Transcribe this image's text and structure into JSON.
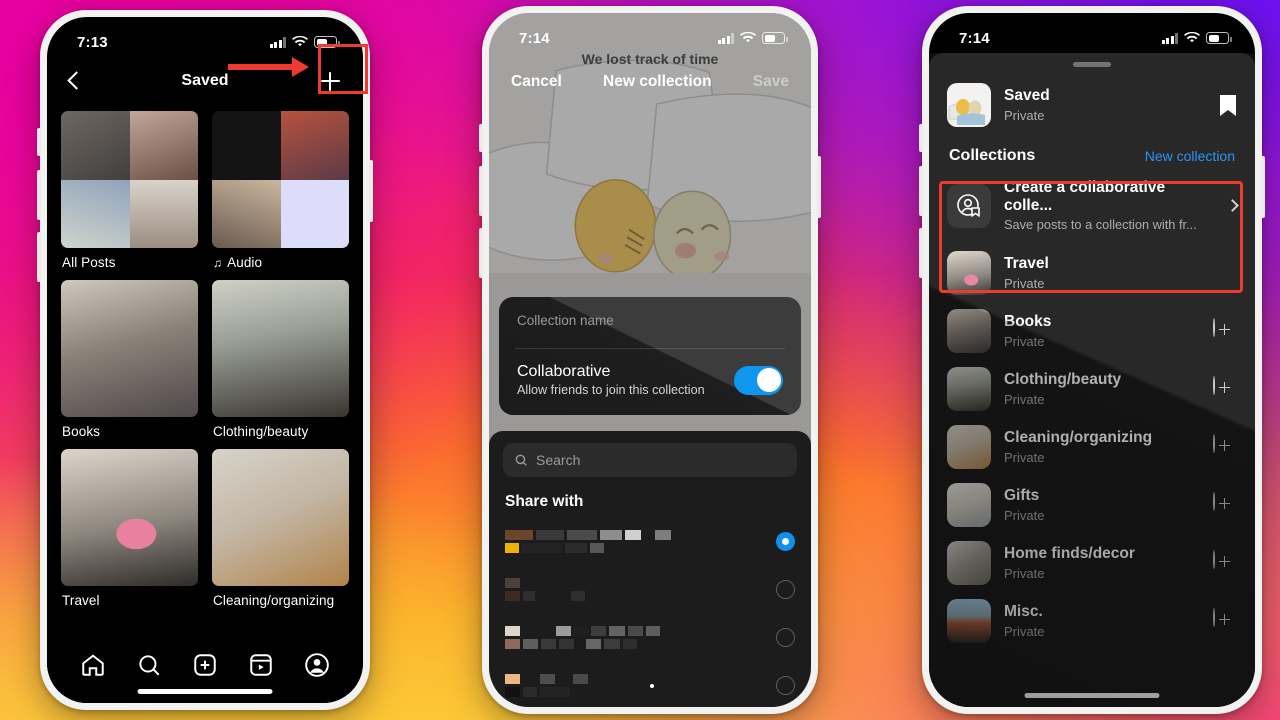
{
  "colors": {
    "accent_blue": "#1f8ff5",
    "toggle_blue": "#0f97f0",
    "annotation_red": "#ee3b30",
    "sheet_bg": "#1c1c1c",
    "screen_bg": "#000000"
  },
  "phone1": {
    "status": {
      "time": "7:13",
      "signal_icon": "cellular-bars-icon",
      "wifi_icon": "wifi-icon",
      "battery_icon": "battery-icon"
    },
    "header": {
      "back_icon": "chevron-left-icon",
      "title": "Saved",
      "add_icon": "plus-icon"
    },
    "collections": [
      {
        "label": "All Posts",
        "icon": "",
        "thumb": "grid-of-four-posts"
      },
      {
        "label": "Audio",
        "icon": "music-note-icon",
        "thumb": "grid-of-four-posts"
      },
      {
        "label": "Books",
        "icon": "",
        "thumb": "book-on-bed-photo"
      },
      {
        "label": "Clothing/beauty",
        "icon": "",
        "thumb": "woman-white-shirt-photo"
      },
      {
        "label": "Travel",
        "icon": "",
        "thumb": "travel-toiletry-bag-photo"
      },
      {
        "label": "Cleaning/organizing",
        "icon": "",
        "thumb": "organized-drawer-photo"
      }
    ],
    "tabbar": [
      {
        "name": "home-icon"
      },
      {
        "name": "search-icon"
      },
      {
        "name": "create-icon"
      },
      {
        "name": "reels-icon"
      },
      {
        "name": "profile-icon"
      }
    ],
    "annotation": {
      "arrow": "red-arrow-pointing-right",
      "highlight": "red-box-around-plus-button"
    }
  },
  "phone2": {
    "status": {
      "time": "7:14"
    },
    "background_caption": "We lost track of time",
    "header": {
      "cancel": "Cancel",
      "title": "New collection",
      "save": "Save"
    },
    "name_card": {
      "input_placeholder": "Collection name",
      "input_value": "",
      "collaborative_title": "Collaborative",
      "collaborative_subtitle": "Allow friends to join this collection",
      "toggle_state": "on"
    },
    "search": {
      "placeholder": "Search",
      "icon": "search-icon"
    },
    "share_with_title": "Share with",
    "share_with_rows": [
      {
        "selected": true
      },
      {
        "selected": false
      },
      {
        "selected": false
      },
      {
        "selected": false
      }
    ]
  },
  "phone3": {
    "status": {
      "time": "7:14"
    },
    "grabber": "sheet-drag-handle",
    "saved_row": {
      "title": "Saved",
      "subtitle": "Private",
      "icon": "bookmark-filled-icon",
      "thumb": "sleeping-characters-illustration"
    },
    "collections_header": {
      "title": "Collections",
      "action": "New collection"
    },
    "collaborative_row": {
      "title": "Create a collaborative colle...",
      "subtitle": "Save posts to a collection with fr...",
      "icon": "collaborative-collection-icon",
      "chevron": "chevron-right-icon"
    },
    "items": [
      {
        "title": "Travel",
        "subtitle": "Private",
        "action": "check-icon",
        "thumb": "travel-toiletry-bag-photo"
      },
      {
        "title": "Books",
        "subtitle": "Private",
        "action": "plus-circle-icon",
        "thumb": "book-on-bed-photo"
      },
      {
        "title": "Clothing/beauty",
        "subtitle": "Private",
        "action": "plus-circle-icon",
        "thumb": "woman-white-shirt-photo"
      },
      {
        "title": "Cleaning/organizing",
        "subtitle": "Private",
        "action": "plus-circle-icon",
        "thumb": "organized-drawer-photo"
      },
      {
        "title": "Gifts",
        "subtitle": "Private",
        "action": "plus-circle-icon",
        "thumb": "gift-cards-photo"
      },
      {
        "title": "Home finds/decor",
        "subtitle": "Private",
        "action": "plus-circle-icon",
        "thumb": "photo-collage-photo"
      },
      {
        "title": "Misc.",
        "subtitle": "Private",
        "action": "plus-circle-icon",
        "thumb": "person-on-mountain-photo"
      }
    ],
    "annotation": {
      "highlight": "red-box-around-collections-section"
    }
  }
}
